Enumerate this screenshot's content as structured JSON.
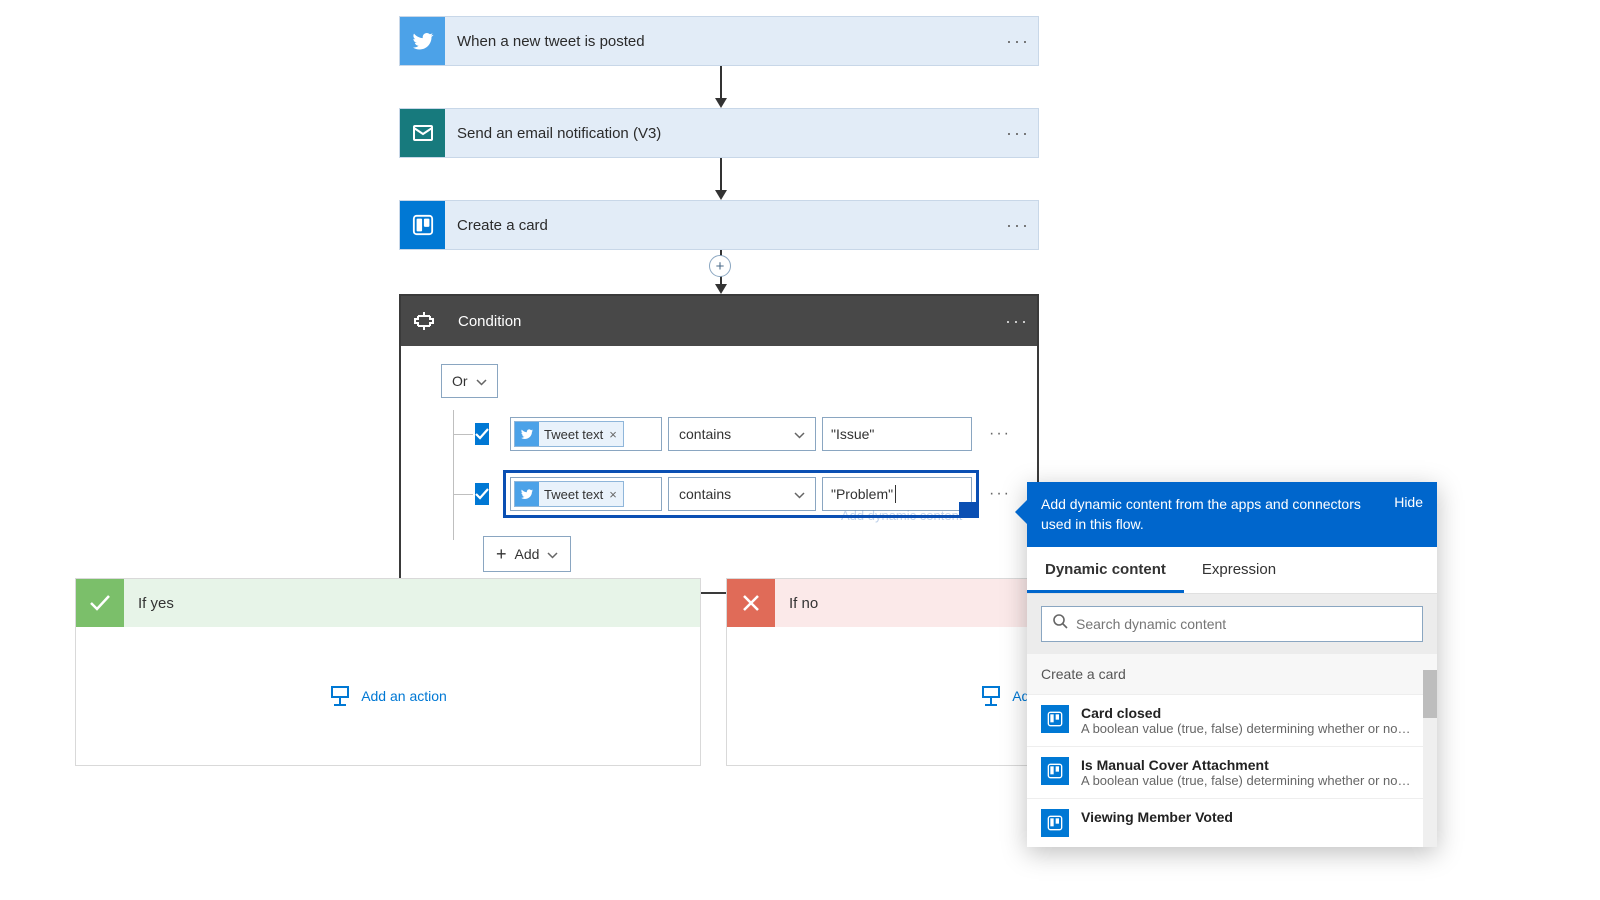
{
  "steps": [
    {
      "title": "When a new tweet is posted",
      "icon": "twitter"
    },
    {
      "title": "Send an email notification (V3)",
      "icon": "mail"
    },
    {
      "title": "Create a card",
      "icon": "trello"
    }
  ],
  "condition": {
    "title": "Condition",
    "group_operator": "Or",
    "rows": [
      {
        "token": "Tweet text",
        "operator": "contains",
        "value": "\"Issue\""
      },
      {
        "token": "Tweet text",
        "operator": "contains",
        "value": "\"Problem\""
      }
    ],
    "add_label": "Add",
    "add_dynamic_link": "Add dynamic content"
  },
  "branches": {
    "yes_label": "If yes",
    "no_label": "If no",
    "add_action_label": "Add an action"
  },
  "dynamic_panel": {
    "head_text": "Add dynamic content from the apps and connectors used in this flow.",
    "hide_label": "Hide",
    "tabs": {
      "dynamic": "Dynamic content",
      "expression": "Expression"
    },
    "search_placeholder": "Search dynamic content",
    "group_title": "Create a card",
    "items": [
      {
        "title": "Card closed",
        "desc": "A boolean value (true, false) determining whether or not ..."
      },
      {
        "title": "Is Manual Cover Attachment",
        "desc": "A boolean value (true, false) determining whether or not ..."
      },
      {
        "title": "Viewing Member Voted",
        "desc": ""
      }
    ]
  }
}
